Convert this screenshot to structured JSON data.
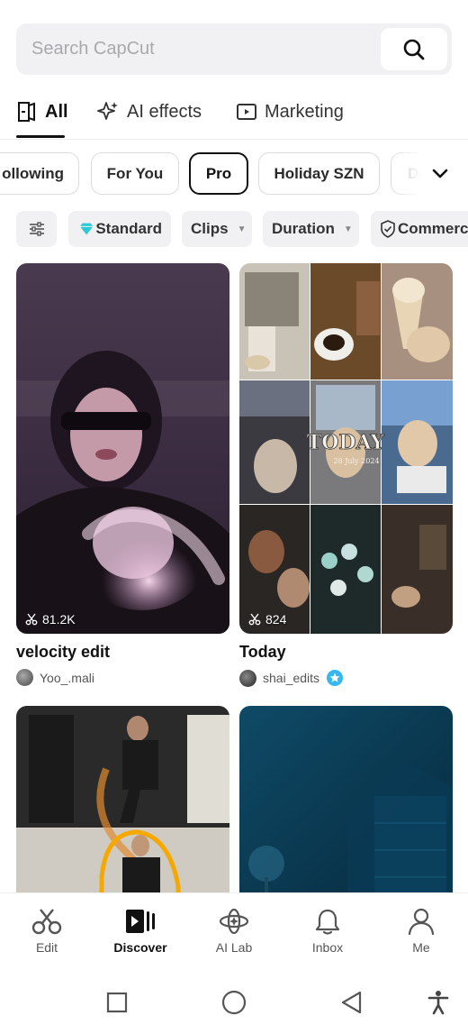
{
  "search": {
    "placeholder": "Search CapCut"
  },
  "main_tabs": [
    {
      "label": "All",
      "icon": "template-icon",
      "active": true
    },
    {
      "label": "AI effects",
      "icon": "ai-sparkle-icon",
      "active": false
    },
    {
      "label": "Marketing",
      "icon": "play-box-icon",
      "active": false
    }
  ],
  "categories": [
    {
      "label": "Following",
      "visible_text": "ollowing"
    },
    {
      "label": "For You"
    },
    {
      "label": "Pro",
      "active": true
    },
    {
      "label": "Holiday SZN"
    },
    {
      "label": "Da"
    }
  ],
  "filters": [
    {
      "label": "",
      "icon": "sliders-icon"
    },
    {
      "label": "Standard",
      "icon": "diamond-icon"
    },
    {
      "label": "Clips",
      "caret": true
    },
    {
      "label": "Duration",
      "caret": true
    },
    {
      "label": "Commerc",
      "icon": "shield-check-icon"
    }
  ],
  "cards": [
    {
      "title": "velocity edit",
      "author": "Yoo_.mali",
      "uses": "81.2K"
    },
    {
      "title": "Today",
      "author": "shai_edits",
      "uses": "824",
      "verified": true,
      "overlay_text": "TODAY",
      "overlay_subtext": "28 July 2024"
    },
    {
      "title": "",
      "author": "",
      "uses": ""
    },
    {
      "title": "",
      "author": "",
      "uses": ""
    }
  ],
  "bottom_nav": [
    {
      "label": "Edit",
      "icon": "scissors-icon"
    },
    {
      "label": "Discover",
      "icon": "discover-icon",
      "active": true
    },
    {
      "label": "AI Lab",
      "icon": "ai-lab-icon"
    },
    {
      "label": "Inbox",
      "icon": "bell-icon"
    },
    {
      "label": "Me",
      "icon": "person-icon"
    }
  ],
  "colors": {
    "accent": "#111111",
    "verified_badge": "#35b8f0",
    "diamond": "#2ec7d6",
    "chip_border": "#dcdcde",
    "search_bg": "#f1f1f3"
  }
}
